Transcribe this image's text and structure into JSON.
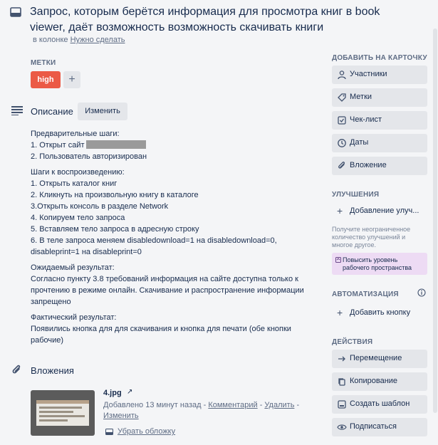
{
  "card": {
    "title": "Запрос, которым берётся информация для просмотра книг в book viewer, даёт возможность возможность скачивать книги",
    "in_list_prefix": "в колонке",
    "list_name": "Нужно сделать"
  },
  "labels": {
    "heading": "МЕТКИ",
    "items": [
      "high"
    ],
    "add_symbol": "+",
    "high_color": "#eb5a46"
  },
  "description": {
    "heading": "Описание",
    "edit_label": "Изменить",
    "lines": [
      "Предварительные шаги:",
      "1. Открыт сайт",
      "2. Пользователь авторизирован",
      "Шаги к воспроизведению:",
      "1. Открыть каталог книг",
      "2. Кликнуть на произвольную книгу в каталоге",
      "3.Открыть консоль в разделе Network",
      "4. Копируем тело запроса",
      "5. Вставляем тело запроса в адресную строку",
      "6. В теле запроса меняем disabledownload=1 на disabledownload=0,",
      "disableprint=1 на disableprint=0",
      "Ожидаемый результат:",
      "Согласно пункту 3.8 требований информация на сайте доступна только к",
      "прочтению в режиме онлайн. Скачивание и распространение информации",
      "запрещено",
      "Фактический результат:",
      "Появились кнопка для для скачивания и кнопка для печати (обе кнопки",
      "рабочие)"
    ]
  },
  "attachments": {
    "heading": "Вложения",
    "items": [
      {
        "name": "4.jpg",
        "added_text": "Добавлено 13 минут назад",
        "sep1": " - ",
        "comment_label": "Комментарий",
        "sep2": " - ",
        "delete_label": "Удалить",
        "sep3": " -",
        "edit_label": "Изменить",
        "cover_label": "Убрать обложку"
      }
    ]
  },
  "sidebar": {
    "add_heading": "ДОБАВИТЬ НА КАРТОЧКУ",
    "add_items": [
      {
        "label": "Участники",
        "icon": "person-icon"
      },
      {
        "label": "Метки",
        "icon": "tag-icon"
      },
      {
        "label": "Чек-лист",
        "icon": "checklist-icon"
      },
      {
        "label": "Даты",
        "icon": "clock-icon"
      },
      {
        "label": "Вложение",
        "icon": "paperclip-icon"
      }
    ],
    "powerups_heading": "УЛУЧШЕНИЯ",
    "add_powerup_label": "Добавление улуч...",
    "powerups_note": "Получите неограниченное количество улучшений и многое другое.",
    "upgrade_label": "Повысить уровень рабочего пространства",
    "automation_heading": "АВТОМАТИЗАЦИЯ",
    "add_button_label": "Добавить кнопку",
    "actions_heading": "ДЕЙСТВИЯ",
    "actions": [
      {
        "label": "Перемещение",
        "icon": "arrow-right-icon"
      },
      {
        "label": "Копирование",
        "icon": "copy-icon"
      },
      {
        "label": "Создать шаблон",
        "icon": "template-icon"
      },
      {
        "label": "Подписаться",
        "icon": "eye-icon"
      }
    ]
  }
}
